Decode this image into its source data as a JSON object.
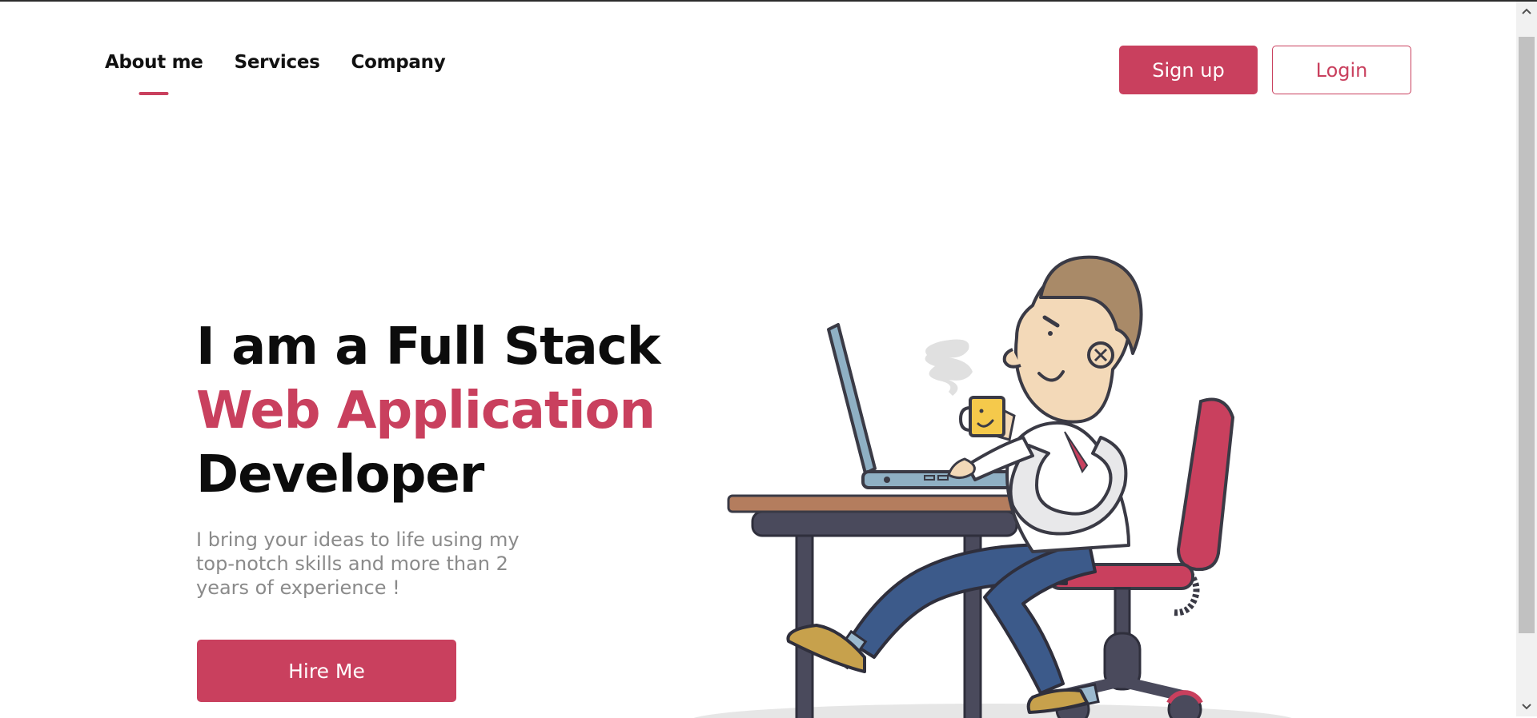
{
  "colors": {
    "accent": "#c9405e"
  },
  "nav": {
    "items": [
      {
        "label": "About me",
        "active": true
      },
      {
        "label": "Services",
        "active": false
      },
      {
        "label": "Company",
        "active": false
      }
    ]
  },
  "auth": {
    "signup_label": "Sign up",
    "login_label": "Login"
  },
  "hero": {
    "title_line1": "I am a Full Stack",
    "title_line2": "Web Application",
    "title_line3": "Developer",
    "description": "I bring your ideas to life using my top-notch skills and more than 2 years of experience !",
    "cta_label": "Hire Me"
  },
  "illustration": {
    "icon": "developer-at-desk-illustration"
  },
  "scrollbar": {
    "up_icon": "chevron-up-icon",
    "down_icon": "chevron-down-icon"
  }
}
